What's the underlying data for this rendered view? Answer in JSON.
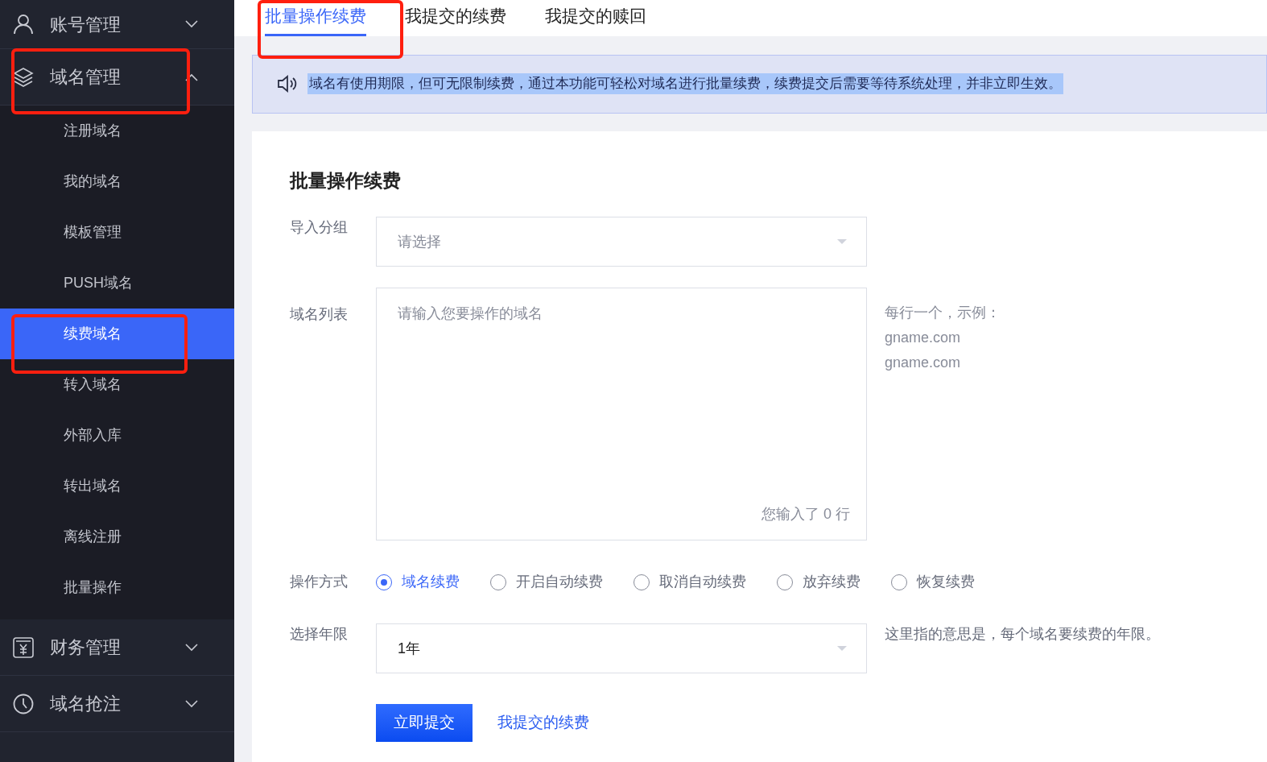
{
  "sidebar": {
    "groups": [
      {
        "label": "账号管理",
        "expanded": false
      },
      {
        "label": "域名管理",
        "expanded": true,
        "items": [
          {
            "label": "注册域名",
            "selected": false
          },
          {
            "label": "我的域名",
            "selected": false
          },
          {
            "label": "模板管理",
            "selected": false
          },
          {
            "label": "PUSH域名",
            "selected": false
          },
          {
            "label": "续费域名",
            "selected": true
          },
          {
            "label": "转入域名",
            "selected": false
          },
          {
            "label": "外部入库",
            "selected": false
          },
          {
            "label": "转出域名",
            "selected": false
          },
          {
            "label": "离线注册",
            "selected": false
          },
          {
            "label": "批量操作",
            "selected": false
          }
        ]
      },
      {
        "label": "财务管理",
        "expanded": false
      },
      {
        "label": "域名抢注",
        "expanded": false
      }
    ]
  },
  "tabs": [
    {
      "label": "批量操作续费",
      "selected": true
    },
    {
      "label": "我提交的续费",
      "selected": false
    },
    {
      "label": "我提交的赎回",
      "selected": false
    }
  ],
  "notice": "域名有使用期限，但可无限制续费，通过本功能可轻松对域名进行批量续费，续费提交后需要等待系统处理，并非立即生效。",
  "form": {
    "title": "批量操作续费",
    "group": {
      "label": "导入分组",
      "placeholder": "请选择"
    },
    "domains": {
      "label": "域名列表",
      "placeholder": "请输入您要操作的域名",
      "count_prefix": "您输入了",
      "count": "0",
      "count_suffix": "行",
      "hint": [
        "每行一个，示例：",
        "gname.com",
        "gname.com"
      ]
    },
    "operation": {
      "label": "操作方式",
      "options": [
        {
          "label": "域名续费",
          "selected": true
        },
        {
          "label": "开启自动续费",
          "selected": false
        },
        {
          "label": "取消自动续费",
          "selected": false
        },
        {
          "label": "放弃续费",
          "selected": false
        },
        {
          "label": "恢复续费",
          "selected": false
        }
      ]
    },
    "years": {
      "label": "选择年限",
      "value": "1年",
      "hint": "这里指的意思是，每个域名要续费的年限。"
    },
    "submit": "立即提交",
    "link": "我提交的续费"
  }
}
